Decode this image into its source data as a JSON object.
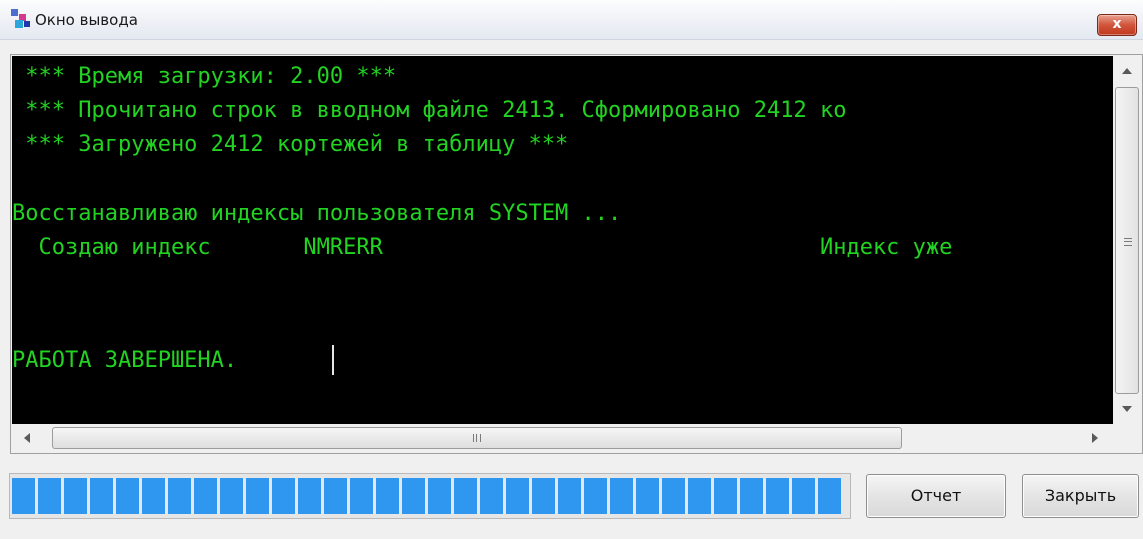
{
  "window": {
    "title": "Окно вывода",
    "close_glyph": "x"
  },
  "console": {
    "lines": [
      " *** Время загрузки: 2.00 ***",
      " *** Прочитано строк в вводном файле 2413. Сформировано 2412 ко",
      " *** Загружено 2412 кортежей в таблицу ***",
      "",
      "Восстанавливаю индексы пользователя SYSTEM ...",
      "  Создаю индекс       NMRERR                                 Индекс уже",
      "",
      "",
      "РАБОТА ЗАВЕРШЕНА."
    ],
    "text_color": "#22d322",
    "background": "#000000"
  },
  "scrollbars": {
    "horizontal_grip": "III"
  },
  "progress": {
    "fraction": 1.0,
    "color": "#2f97f0"
  },
  "buttons": {
    "report_label": "Отчет",
    "close_label": "Закрыть"
  },
  "icons": {
    "app_icon": "output-window-icon",
    "close_icon": "close-icon"
  }
}
